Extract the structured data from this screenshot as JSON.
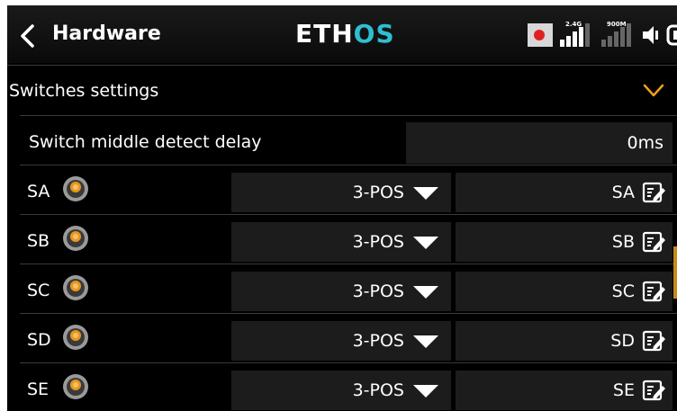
{
  "header": {
    "title": "Hardware",
    "logo_main": "ETH",
    "logo_accent": "OS",
    "logo_accent_color": "#2dbfd1",
    "signal_1_label": "2.4G",
    "signal_2_label": "900M",
    "icons": [
      "back-chevron-icon",
      "record-icon",
      "signal-2-4g-icon",
      "signal-900m-icon",
      "speaker-icon",
      "battery-icon"
    ]
  },
  "section": {
    "label": "Switches settings",
    "chevron_color": "#f0a020"
  },
  "delay": {
    "label": "Switch middle detect delay",
    "value": "0ms"
  },
  "switches": [
    {
      "label": "SA",
      "type": "3-POS",
      "name": "SA"
    },
    {
      "label": "SB",
      "type": "3-POS",
      "name": "SB"
    },
    {
      "label": "SC",
      "type": "3-POS",
      "name": "SC"
    },
    {
      "label": "SD",
      "type": "3-POS",
      "name": "SD"
    },
    {
      "label": "SE",
      "type": "3-POS",
      "name": "SE"
    }
  ]
}
